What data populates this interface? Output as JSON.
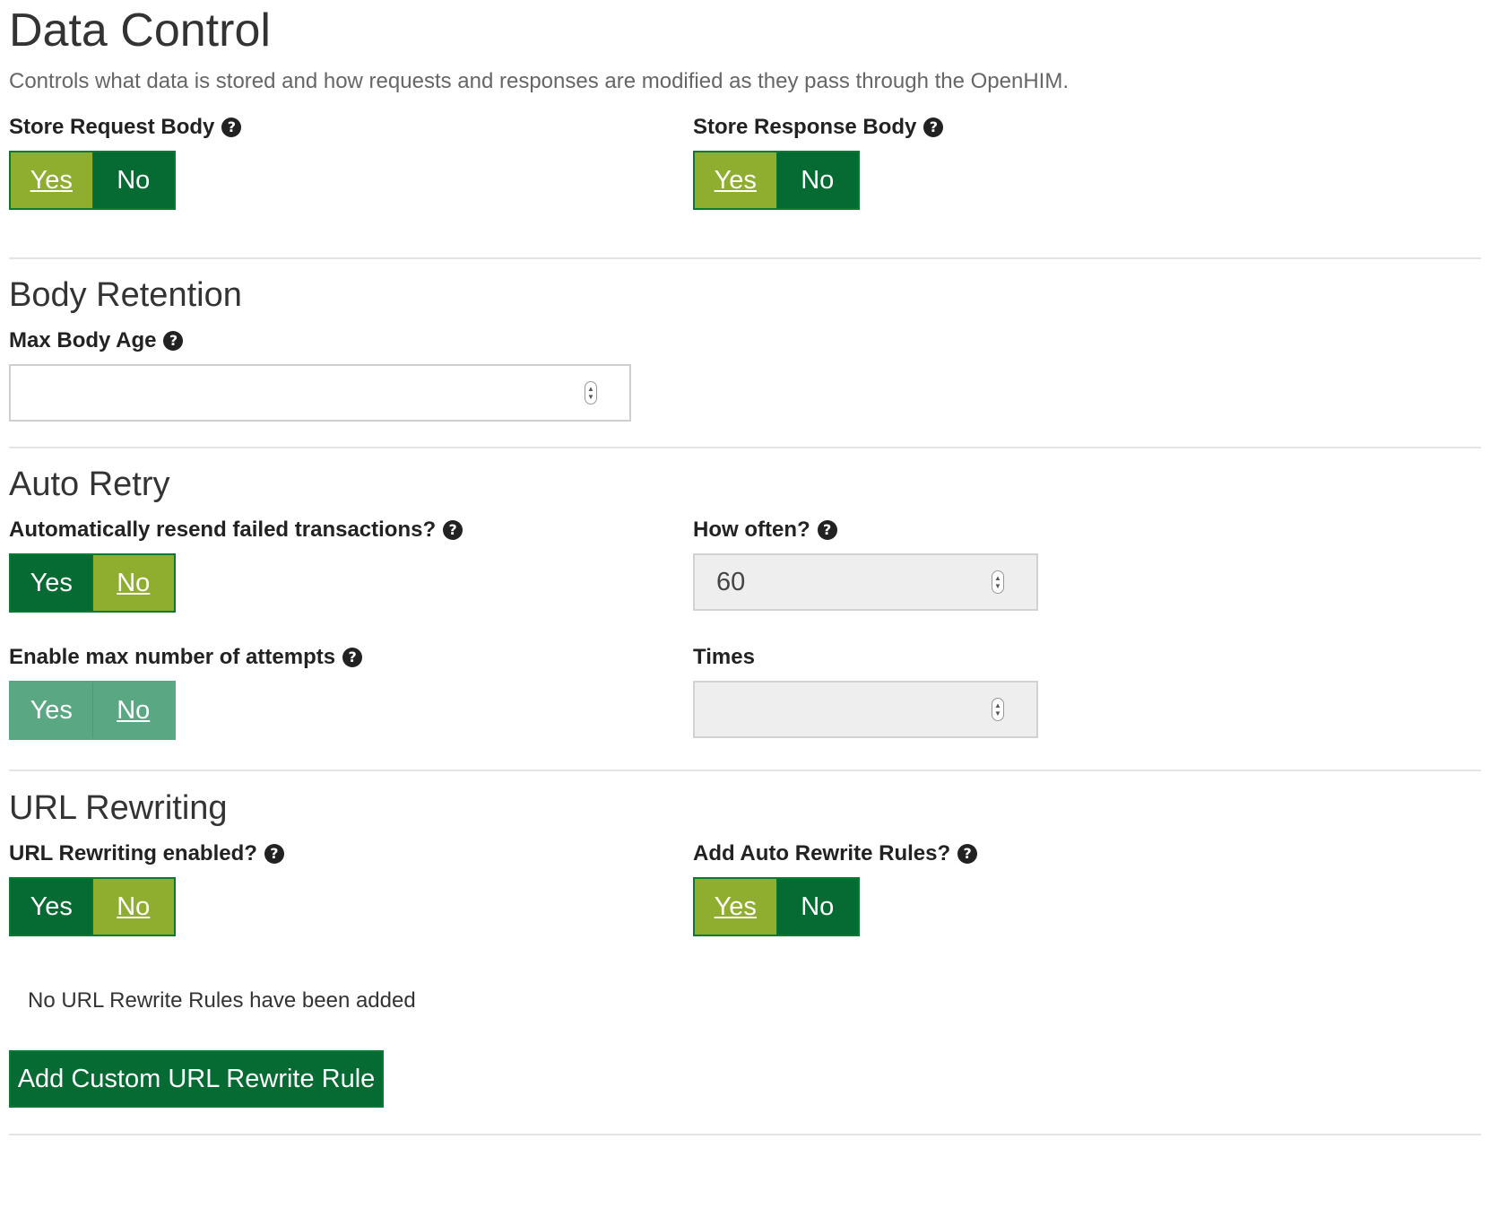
{
  "title": "Data Control",
  "description": "Controls what data is stored and how requests and responses are modified as they pass through the OpenHIM.",
  "help_glyph": "?",
  "store_request_body": {
    "label": "Store Request Body",
    "yes": "Yes",
    "no": "No",
    "selected": "Yes"
  },
  "store_response_body": {
    "label": "Store Response Body",
    "yes": "Yes",
    "no": "No",
    "selected": "Yes"
  },
  "body_retention": {
    "heading": "Body Retention",
    "max_body_age_label": "Max Body Age",
    "max_body_age_value": ""
  },
  "auto_retry": {
    "heading": "Auto Retry",
    "resend": {
      "label": "Automatically resend failed transactions?",
      "yes": "Yes",
      "no": "No",
      "selected": "No"
    },
    "how_often": {
      "label": "How often?",
      "value": "60"
    },
    "max_attempts": {
      "label": "Enable max number of attempts",
      "yes": "Yes",
      "no": "No",
      "selected": "No",
      "disabled": true
    },
    "times": {
      "label": "Times",
      "value": ""
    }
  },
  "url_rewriting": {
    "heading": "URL Rewriting",
    "enabled": {
      "label": "URL Rewriting enabled?",
      "yes": "Yes",
      "no": "No",
      "selected": "No"
    },
    "auto_rules": {
      "label": "Add Auto Rewrite Rules?",
      "yes": "Yes",
      "no": "No",
      "selected": "Yes"
    },
    "empty_message": "No URL Rewrite Rules have been added",
    "add_button": "Add Custom URL Rewrite Rule"
  },
  "colors": {
    "toggle_dark": "#066b32",
    "toggle_active": "#8fae2f",
    "toggle_disabled": "#5aa883",
    "rule": "#e4e4e4"
  }
}
